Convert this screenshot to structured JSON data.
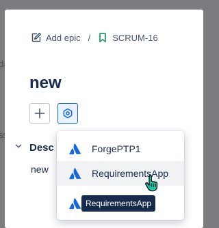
{
  "background": {
    "snippets": [
      "da",
      "ss"
    ]
  },
  "breadcrumb": {
    "add_epic_label": "Add epic",
    "separator": "/",
    "issue_key": "SCRUM-16"
  },
  "issue": {
    "title": "new"
  },
  "description": {
    "label": "Desc",
    "value": "new"
  },
  "apps_menu": {
    "items": [
      {
        "label": "ForgePTP1",
        "icon": "atlassian-logo-icon"
      },
      {
        "label": "RequirementsApp",
        "icon": "atlassian-logo-icon",
        "hovered": true
      },
      {
        "label": "",
        "icon": "atlassian-logo-icon"
      }
    ]
  },
  "tooltip": {
    "text": "RequirementsApp"
  },
  "colors": {
    "brand_blue": "#1868db",
    "selected_border": "#0c66e4",
    "text_primary": "#172b4d",
    "text_subtle": "#44546f",
    "issue_key_green": "#22a06b"
  }
}
